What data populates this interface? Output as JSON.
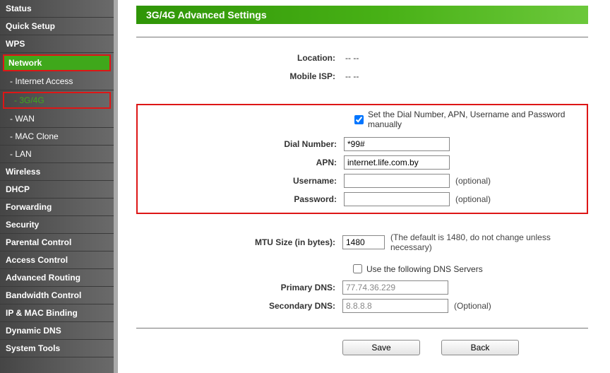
{
  "sidebar": {
    "items": [
      {
        "label": "Status",
        "cls": "nav-item"
      },
      {
        "label": "Quick Setup",
        "cls": "nav-item"
      },
      {
        "label": "WPS",
        "cls": "nav-item"
      },
      {
        "label": "Network",
        "cls": "nav-item active hl-red"
      },
      {
        "label": "- Internet Access",
        "cls": "nav-item sub"
      },
      {
        "label": "- 3G/4G",
        "cls": "nav-item sub current hl-red"
      },
      {
        "label": "- WAN",
        "cls": "nav-item sub"
      },
      {
        "label": "- MAC Clone",
        "cls": "nav-item sub"
      },
      {
        "label": "- LAN",
        "cls": "nav-item sub"
      },
      {
        "label": "Wireless",
        "cls": "nav-item"
      },
      {
        "label": "DHCP",
        "cls": "nav-item"
      },
      {
        "label": "Forwarding",
        "cls": "nav-item"
      },
      {
        "label": "Security",
        "cls": "nav-item"
      },
      {
        "label": "Parental Control",
        "cls": "nav-item"
      },
      {
        "label": "Access Control",
        "cls": "nav-item"
      },
      {
        "label": "Advanced Routing",
        "cls": "nav-item"
      },
      {
        "label": "Bandwidth Control",
        "cls": "nav-item"
      },
      {
        "label": "IP & MAC Binding",
        "cls": "nav-item"
      },
      {
        "label": "Dynamic DNS",
        "cls": "nav-item"
      },
      {
        "label": "System Tools",
        "cls": "nav-item"
      }
    ]
  },
  "page": {
    "title": "3G/4G Advanced Settings",
    "location_label": "Location:",
    "location_value": "--  --",
    "isp_label": "Mobile ISP:",
    "isp_value": "--  --",
    "manual_label": "Set the Dial Number, APN, Username and Password manually",
    "dial_label": "Dial Number:",
    "dial_value": "*99#",
    "apn_label": "APN:",
    "apn_value": "internet.life.com.by",
    "user_label": "Username:",
    "user_value": "",
    "user_opt": "(optional)",
    "pass_label": "Password:",
    "pass_value": "",
    "pass_opt": "(optional)",
    "mtu_label": "MTU Size (in bytes):",
    "mtu_value": "1480",
    "mtu_hint": "(The default is 1480, do not change unless necessary)",
    "dns_chk_label": "Use the following DNS Servers",
    "pdns_label": "Primary DNS:",
    "pdns_value": "77.74.36.229",
    "sdns_label": "Secondary DNS:",
    "sdns_value": "8.8.8.8",
    "sdns_opt": "(Optional)",
    "save": "Save",
    "back": "Back"
  }
}
